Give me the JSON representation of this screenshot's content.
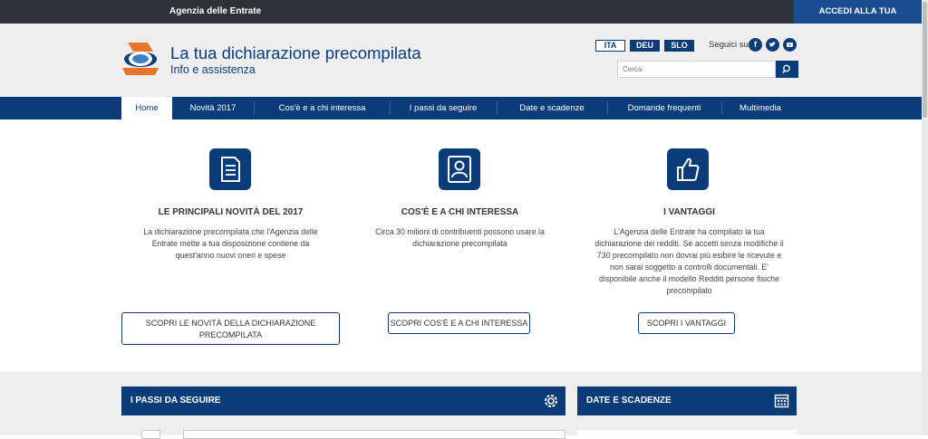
{
  "topbar": {
    "brand": "Agenzia delle Entrate",
    "access_label": "ACCEDI ALLA TUA PRECOMPILATA"
  },
  "header": {
    "title": "La tua dichiarazione precompilata",
    "subtitle": "Info e assistenza",
    "languages": [
      "ITA",
      "DEU",
      "SLO"
    ],
    "follow_label": "Seguici su",
    "social": [
      "facebook-icon",
      "twitter-icon",
      "youtube-icon"
    ],
    "search_placeholder": "Cerca"
  },
  "nav": {
    "items": [
      "Home",
      "Novità 2017",
      "Cos'è e a chi interessa",
      "I passi da seguire",
      "Date e scadenze",
      "Domande frequenti",
      "Multimedia"
    ],
    "active_index": 0
  },
  "features": [
    {
      "icon": "document-icon",
      "title": "LE PRINCIPALI NOVITÀ DEL 2017",
      "lines": [
        "La dichiarazione precompilata che l'Agenzia delle",
        "Entrate mette a tua disposizione contiene da",
        "quest'anno nuovi oneri e spese"
      ],
      "button": [
        "SCOPRI LE NOVITÀ DELLA DICHIARAZIONE",
        "PRECOMPILATA"
      ]
    },
    {
      "icon": "user-icon",
      "title": "COS'È E A CHI INTERESSA",
      "lines": [
        "Circa 30 milioni di contribuenti possono usare la",
        "dichiarazione precompilata"
      ],
      "button": [
        "SCOPRI COS'È E A CHI INTERESSA"
      ]
    },
    {
      "icon": "thumbs-up-icon",
      "title": "I VANTAGGI",
      "lines": [
        "L'Agenzia delle Entrate  ha compilato la tua",
        "dichiarazione dei redditi. Se accetti senza modifiche il",
        "730 precompilato non dovrai più esibire le ricevute e",
        "non sarai soggetto a controlli documentali. E'",
        "disponibile anche il modello Redditi persone fisiche",
        "precompilato"
      ],
      "button": [
        "SCOPRI I VANTAGGI"
      ]
    }
  ],
  "panels": {
    "steps_title": "I PASSI DA SEGUIRE",
    "dates_title": "DATE E SCADENZE"
  },
  "colors": {
    "primary": "#0b3c7a",
    "topbar": "#2e3339",
    "access": "#1a4d8f",
    "header_bg": "#eeeeee"
  }
}
